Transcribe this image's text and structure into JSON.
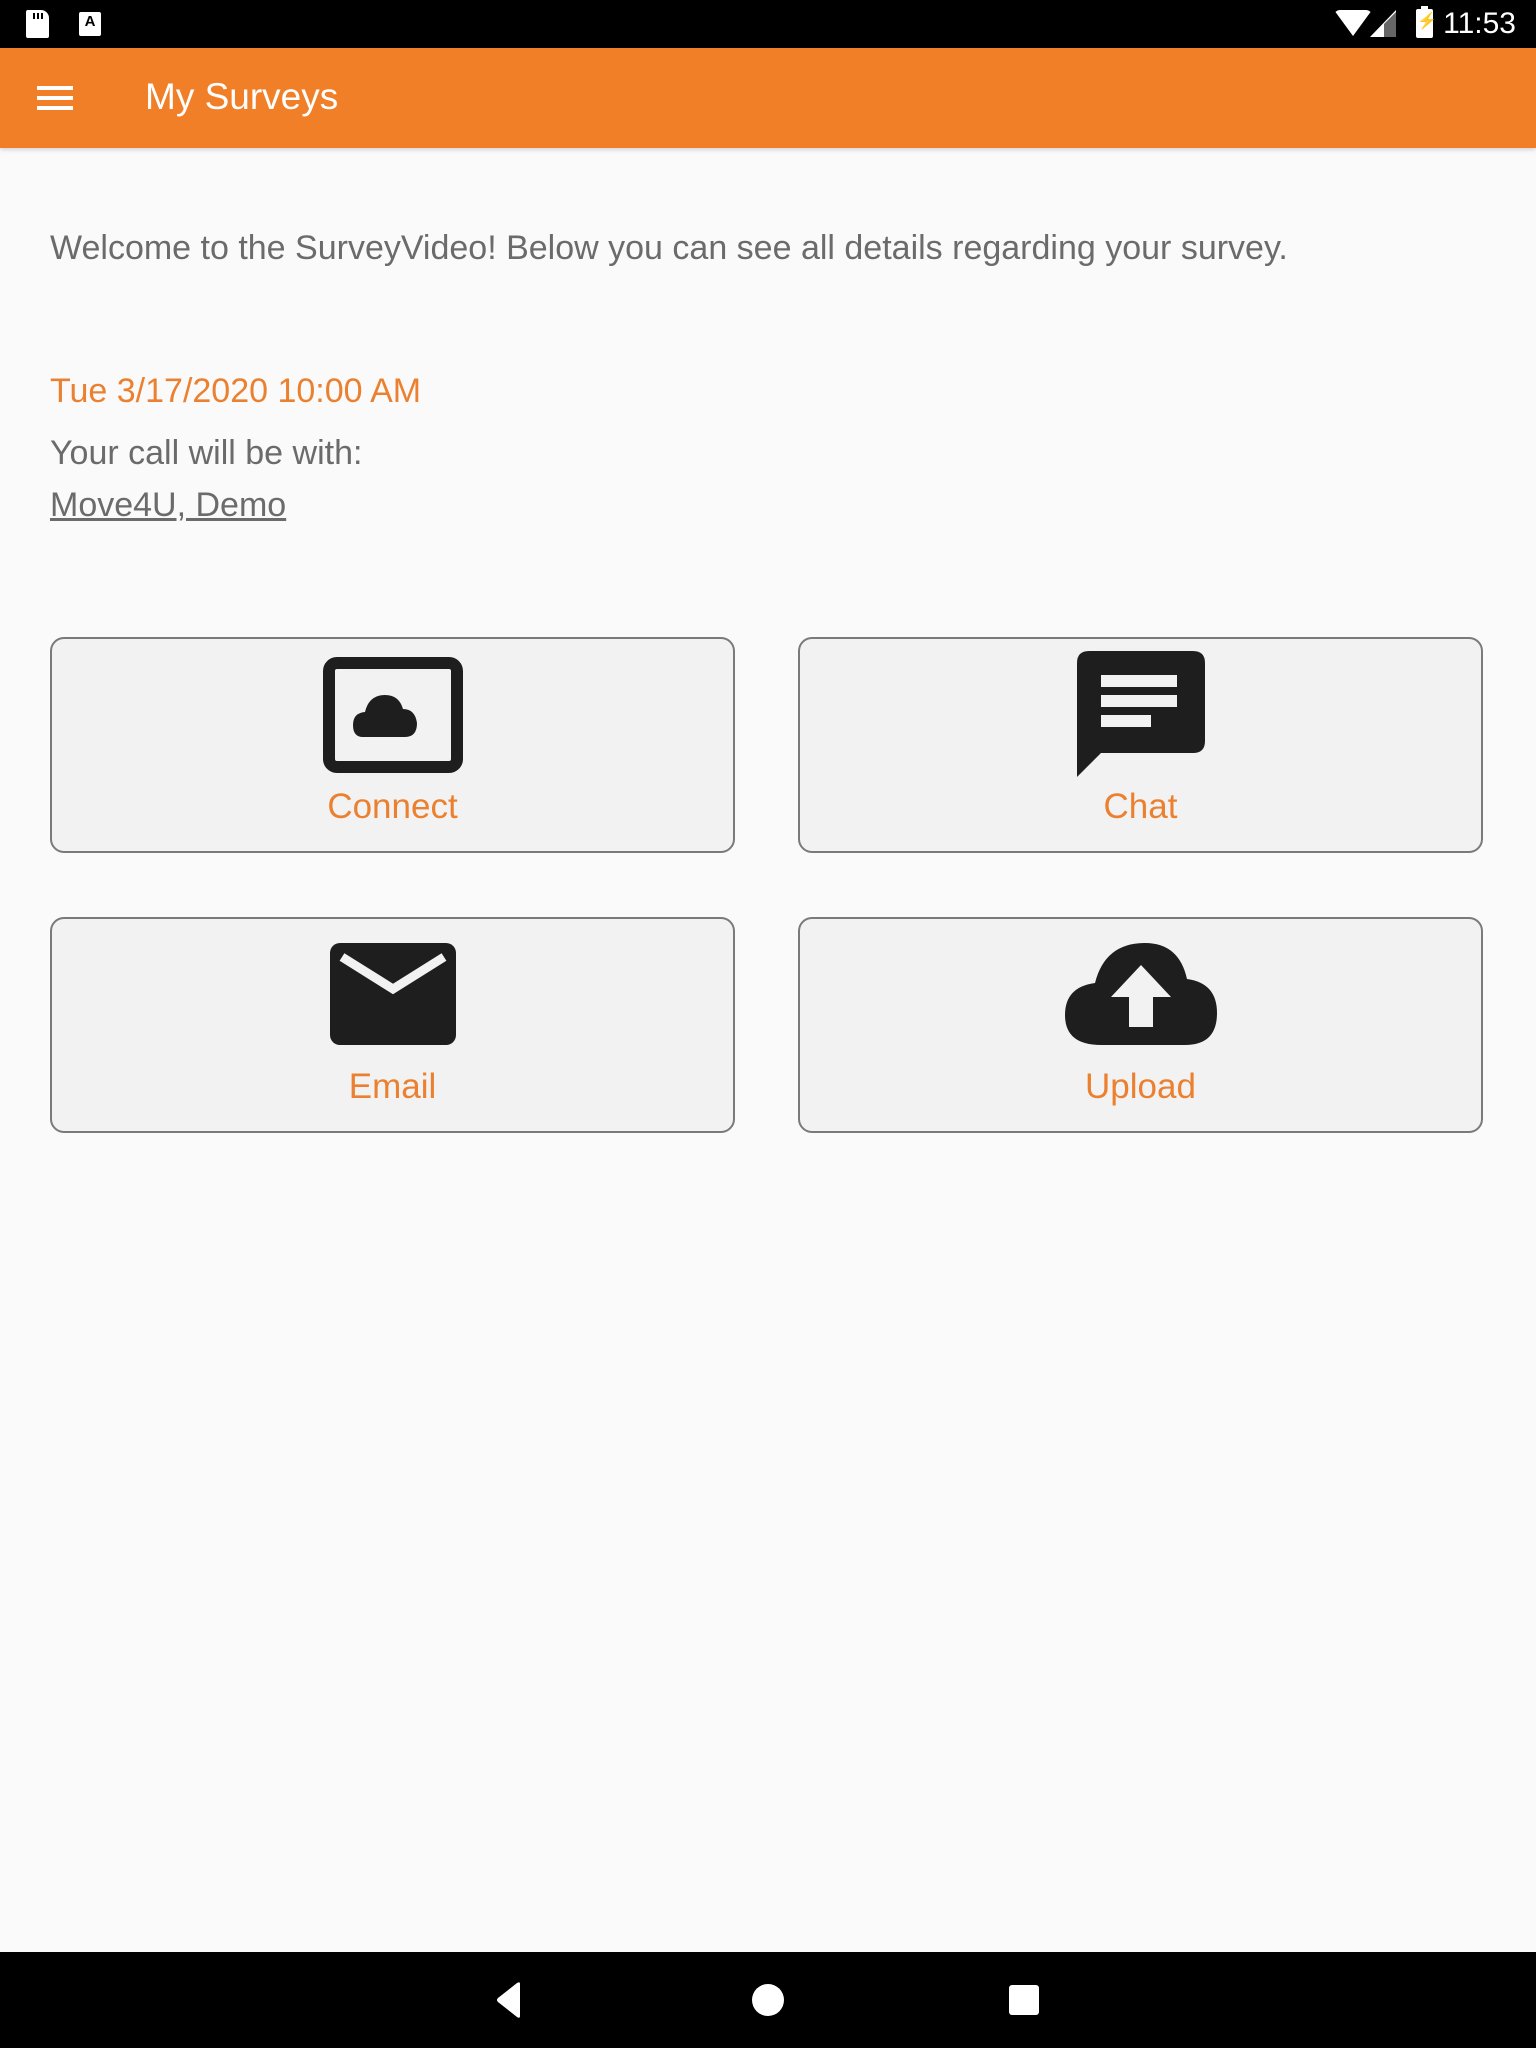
{
  "status_bar": {
    "time": "11:53",
    "left_icons": [
      "sd-card-icon",
      "accessibility-a-icon"
    ],
    "right_icons": [
      "wifi-icon",
      "cell-signal-icon",
      "battery-charging-icon"
    ]
  },
  "app_bar": {
    "menu_icon": "hamburger-menu-icon",
    "title": "My Surveys",
    "color": "#F07F28"
  },
  "content": {
    "welcome": "Welcome to the SurveyVideo! Below you can see all details regarding your survey.",
    "date": "Tue 3/17/2020 10:00 AM",
    "call_label": "Your call will be with:",
    "contact": "Move4U, Demo",
    "accent_color": "#EB8130"
  },
  "actions": [
    {
      "label": "Connect",
      "icon": "video-cloud-icon"
    },
    {
      "label": "Chat",
      "icon": "chat-bubble-icon"
    },
    {
      "label": "Email",
      "icon": "envelope-icon"
    },
    {
      "label": "Upload",
      "icon": "cloud-upload-icon"
    }
  ],
  "nav_bar": {
    "buttons": [
      "back-icon",
      "home-icon",
      "recent-apps-icon"
    ]
  }
}
